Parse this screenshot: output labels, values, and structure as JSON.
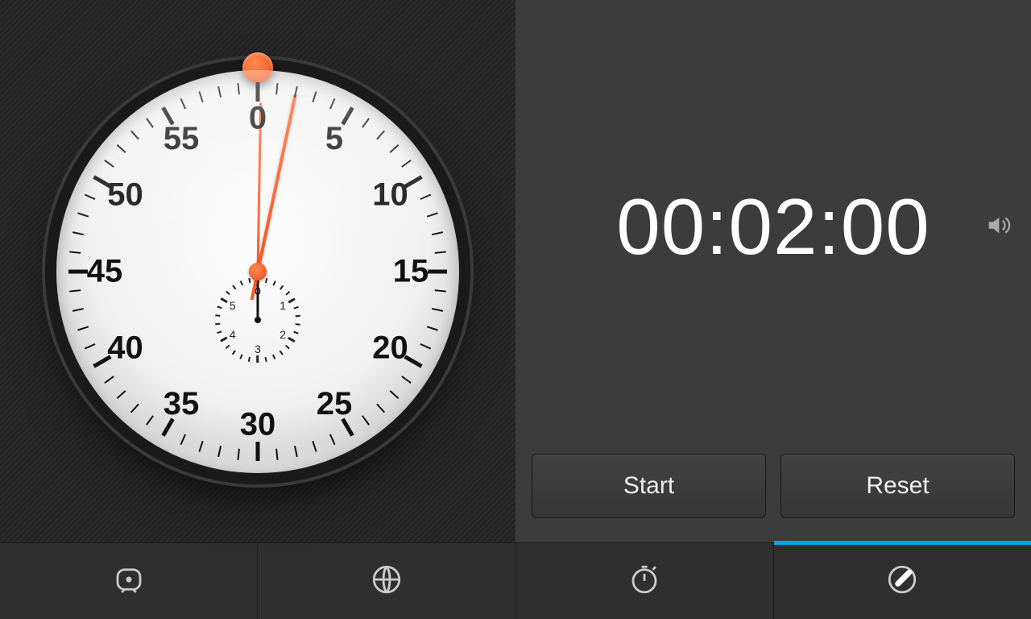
{
  "timer": {
    "display": "00:02:00",
    "start_label": "Start",
    "reset_label": "Reset",
    "sound_on": true
  },
  "dial": {
    "main_numbers": [
      "0",
      "5",
      "10",
      "15",
      "20",
      "25",
      "30",
      "35",
      "40",
      "45",
      "50",
      "55"
    ],
    "sub_numbers": [
      "0",
      "1",
      "2",
      "3",
      "4",
      "5"
    ],
    "second_hand_angle_deg": 12,
    "minute_hand_angle_deg": 1,
    "subdial_hand_angle_deg": 0
  },
  "tabs": {
    "items": [
      "alarm",
      "world-clock",
      "stopwatch",
      "timer"
    ],
    "active": "timer"
  },
  "colors": {
    "accent": "#ff5722",
    "highlight": "#00a8e8"
  }
}
